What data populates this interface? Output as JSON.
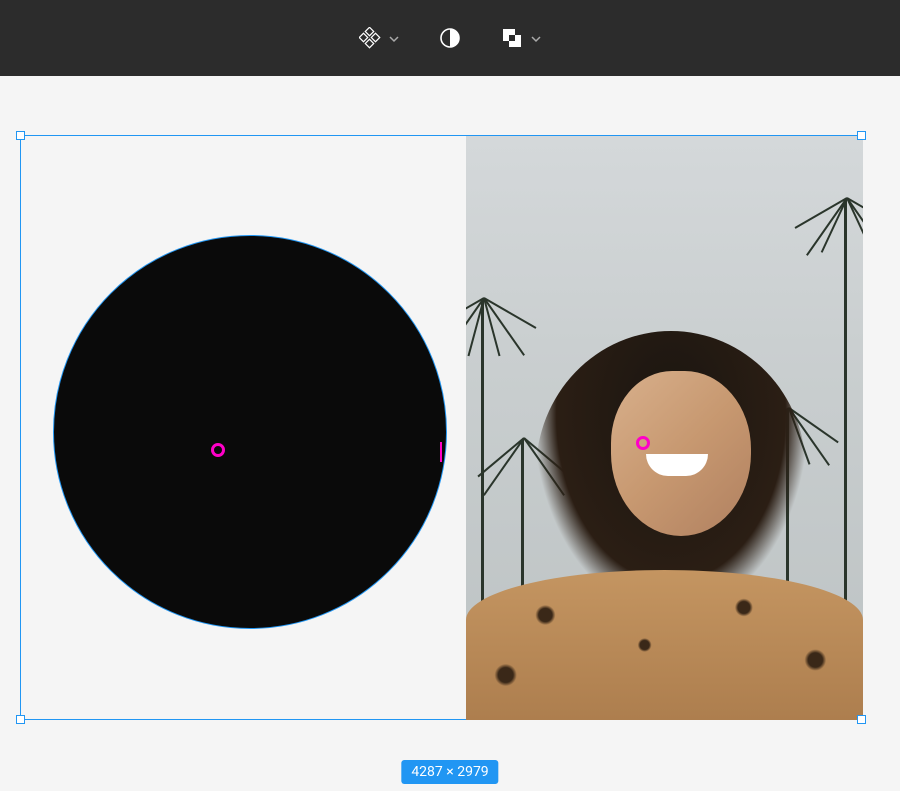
{
  "toolbar": {
    "tools": [
      {
        "name": "components-icon",
        "has_dropdown": true
      },
      {
        "name": "mask-icon",
        "has_dropdown": false
      },
      {
        "name": "boolean-icon",
        "has_dropdown": true
      }
    ]
  },
  "canvas": {
    "selection": {
      "dimensions_label": "4287 × 2979",
      "color": "#2196f3"
    },
    "rotation_point_color": "#ff00c8",
    "objects": [
      {
        "type": "ellipse",
        "fill": "#0a0a0a"
      },
      {
        "type": "image",
        "description": "photo"
      }
    ]
  }
}
